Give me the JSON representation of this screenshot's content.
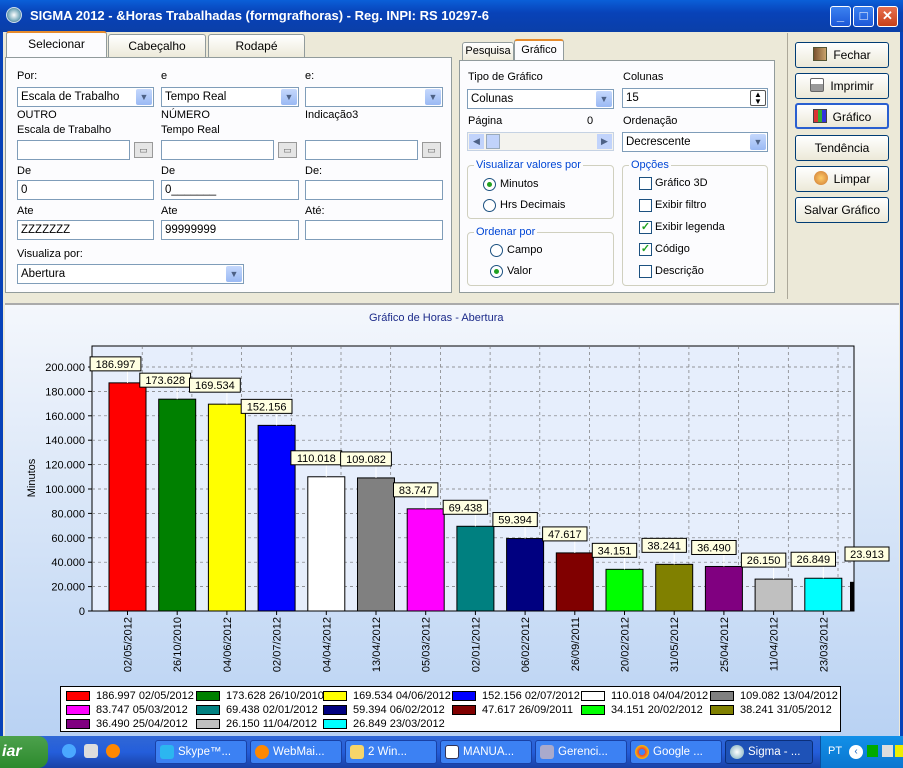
{
  "window": {
    "title": "SIGMA 2012 - &Horas Trabalhadas  (formgrafhoras)  - Reg. INPI: RS 10297-6",
    "min": "_",
    "max": "□",
    "close": "✕"
  },
  "left_tabs": [
    "Selecionar",
    "Cabeçalho",
    "Rodapé"
  ],
  "filters": {
    "col1": {
      "por_label": "Por:",
      "por_value": "Escala de Trabalho",
      "kind": "OUTRO",
      "field_label": "Escala de Trabalho",
      "field_value": "",
      "de_label": "De",
      "de_value": "0",
      "ate_label": "Ate",
      "ate_value": "ZZZZZZZ"
    },
    "col2": {
      "por_label": "e",
      "por_value": "Tempo Real",
      "kind": "NÚMERO",
      "field_label": "Tempo Real",
      "field_value": "",
      "de_label": "De",
      "de_value": "0_______",
      "ate_label": "Ate",
      "ate_value": "99999999"
    },
    "col3": {
      "por_label": "e:",
      "por_value": "",
      "kind": "Indicação3",
      "field_label": "",
      "field_value": "",
      "de_label": "De:",
      "de_value": "",
      "ate_label": "Até:",
      "ate_value": ""
    },
    "visualiza_label": "Visualiza por:",
    "visualiza_value": "Abertura"
  },
  "right_tabs": [
    "Pesquisa",
    "Gráfico"
  ],
  "grafico": {
    "tipo_label": "Tipo de Gráfico",
    "tipo_value": "Colunas",
    "colunas_label": "Colunas",
    "colunas_value": "15",
    "pagina_label": "Página",
    "pagina_value": "0",
    "ordenacao_label": "Ordenação",
    "ordenacao_value": "Decrescente",
    "visualizar_title": "Visualizar valores por",
    "visualizar_opts": [
      "Minutos",
      "Hrs Decimais"
    ],
    "visualizar_sel": 0,
    "ordenar_title": "Ordenar por",
    "ordenar_opts": [
      "Campo",
      "Valor"
    ],
    "ordenar_sel": 1,
    "opcoes_title": "Opções",
    "opcoes": [
      {
        "label": "Gráfico 3D",
        "checked": false
      },
      {
        "label": "Exibir filtro",
        "checked": false
      },
      {
        "label": "Exibir legenda",
        "checked": true
      },
      {
        "label": "Código",
        "checked": true
      },
      {
        "label": "Descrição",
        "checked": false
      }
    ]
  },
  "side_buttons": [
    {
      "label": "Fechar",
      "icon": "door-icon"
    },
    {
      "label": "Imprimir",
      "icon": "printer-icon"
    },
    {
      "label": "Gráfico",
      "icon": "chart-icon"
    },
    {
      "label": "Tendência",
      "icon": ""
    },
    {
      "label": "Limpar",
      "icon": "eraser-icon"
    },
    {
      "label": "Salvar Gráfico",
      "icon": ""
    }
  ],
  "chart_data": {
    "type": "bar",
    "title": "Gráfico de Horas - Abertura",
    "ylabel": "Minutos",
    "ylim": [
      0,
      200000
    ],
    "yticks": [
      "0",
      "20.000",
      "40.000",
      "60.000",
      "80.000",
      "100.000",
      "120.000",
      "140.000",
      "160.000",
      "180.000",
      "200.000"
    ],
    "categories": [
      "02/05/2012",
      "26/10/2010",
      "04/06/2012",
      "02/07/2012",
      "04/04/2012",
      "13/04/2012",
      "05/03/2012",
      "02/01/2012",
      "06/02/2012",
      "26/09/2011",
      "20/02/2012",
      "31/05/2012",
      "25/04/2012",
      "11/04/2012",
      "23/03/2012"
    ],
    "values": [
      186997,
      173628,
      169534,
      152156,
      110018,
      109082,
      83747,
      69438,
      59394,
      47617,
      34151,
      38241,
      36490,
      26150,
      26849
    ],
    "labels": [
      "186.997",
      "173.628",
      "169.534",
      "152.156",
      "110.018",
      "109.082",
      "83.747",
      "69.438",
      "59.394",
      "47.617",
      "34.151",
      "38.241",
      "36.490",
      "26.150",
      "26.849"
    ],
    "colors": [
      "#ff0000",
      "#008000",
      "#ffff00",
      "#0000ff",
      "#ffffff",
      "#808080",
      "#ff00ff",
      "#008080",
      "#000080",
      "#800000",
      "#00ff00",
      "#808000",
      "#800080",
      "#c0c0c0",
      "#00ffff"
    ],
    "extra_label": "23.913",
    "grid": true,
    "legend": [
      "186.997 02/05/2012",
      "173.628 26/10/2010",
      "169.534 04/06/2012",
      "152.156 02/07/2012",
      "110.018 04/04/2012",
      "109.082 13/04/2012",
      "83.747 05/03/2012",
      "69.438 02/01/2012",
      "59.394 06/02/2012",
      "47.617 26/09/2011",
      "34.151 20/02/2012",
      "38.241 31/05/2012",
      "36.490 25/04/2012",
      "26.150 11/04/2012",
      "26.849 23/03/2012"
    ]
  },
  "taskbar": {
    "start": "iar",
    "items": [
      "Skype™...",
      "WebMai...",
      "2 Win...",
      "MANUA...",
      "Gerenci...",
      "Google ...",
      "Sigma - ..."
    ],
    "lang": "PT"
  }
}
